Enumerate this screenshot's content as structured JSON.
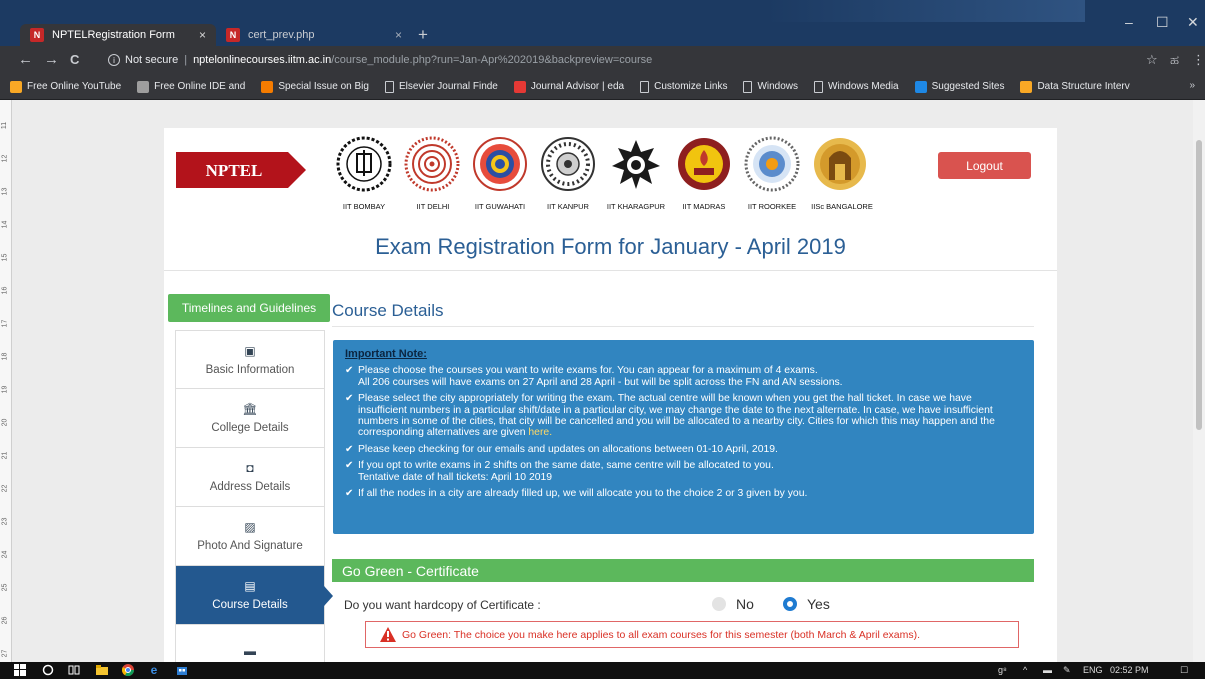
{
  "browser": {
    "tabs": [
      {
        "favicon": "N",
        "title": "NPTELRegistration Form",
        "close": "×"
      },
      {
        "favicon": "N",
        "title": "cert_prev.php",
        "close": "×"
      }
    ],
    "new_tab": "+",
    "window_controls": {
      "minimize": "–",
      "maximize": "☐",
      "close": "✕"
    },
    "nav": {
      "back": "←",
      "forward": "→",
      "reload": "C"
    },
    "address": {
      "security": "Not secure",
      "separator": "|",
      "host": "nptelonlinecourses.iitm.ac.in",
      "path": "/course_module.php?run=Jan-Apr%202019&backpreview=course"
    },
    "toolbar_right": {
      "star": "☆",
      "extension": "ಹ",
      "menu": "⋮"
    },
    "bookmarks": [
      {
        "icon": "download-arrow-icon",
        "color": "#f9a825",
        "label": "Free Online YouTube"
      },
      {
        "icon": "ide-icon",
        "color": "#9e9e9e",
        "label": "Free Online IDE and"
      },
      {
        "icon": "bookmark-page-icon",
        "color": "#f57c00",
        "label": "Special Issue on Big"
      },
      {
        "icon": "page-icon",
        "color": "",
        "label": "Elsevier Journal Finde"
      },
      {
        "icon": "journal-advisor-icon",
        "color": "#e53935",
        "label": "Journal Advisor | eda"
      },
      {
        "icon": "page-icon",
        "color": "",
        "label": "Customize Links"
      },
      {
        "icon": "page-icon",
        "color": "",
        "label": "Windows"
      },
      {
        "icon": "page-icon",
        "color": "",
        "label": "Windows Media"
      },
      {
        "icon": "bing-icon",
        "color": "#1e88e5",
        "label": "Suggested Sites"
      },
      {
        "icon": "data-structure-icon",
        "color": "#f9a825",
        "label": "Data Structure Interv"
      }
    ],
    "bookmarks_overflow": "»"
  },
  "ruler_labels": [
    "11",
    "12",
    "13",
    "14",
    "15",
    "16",
    "17",
    "18",
    "19",
    "20",
    "21",
    "22",
    "23",
    "24",
    "25",
    "26",
    "27"
  ],
  "header": {
    "nptel_logo_text": "NPTEL",
    "institutes": [
      "IIT BOMBAY",
      "IIT DELHI",
      "IIT GUWAHATI",
      "IIT KANPUR",
      "IIT KHARAGPUR",
      "IIT MADRAS",
      "IIT ROORKEE",
      "IISc BANGALORE"
    ],
    "logout_label": "Logout",
    "page_title": "Exam Registration Form for January - April 2019"
  },
  "sidebar": {
    "timelines_label": "Timelines and Guidelines",
    "items": [
      {
        "icon": "id-card-icon",
        "glyph": "▣",
        "label": "Basic Information",
        "active": false
      },
      {
        "icon": "institution-icon",
        "glyph": "🏛",
        "label": "College Details",
        "active": false
      },
      {
        "icon": "address-book-icon",
        "glyph": "◘",
        "label": "Address Details",
        "active": false
      },
      {
        "icon": "photo-icon",
        "glyph": "▨",
        "label": "Photo And Signature",
        "active": false
      },
      {
        "icon": "list-document-icon",
        "glyph": "▤",
        "label": "Course Details",
        "active": true
      },
      {
        "icon": "payment-card-icon",
        "glyph": "▬",
        "label": "",
        "active": false
      }
    ]
  },
  "main": {
    "section_title": "Course Details",
    "note_heading": "Important Note:",
    "notes": [
      {
        "text": "Please choose the courses you want to write exams for. You can appear for a maximum of 4 exams.",
        "text2": "All 206 courses will have exams on 27 April and 28 April - but will be split across the FN and AN sessions."
      },
      {
        "text": "Please select the city appropriately for writing the exam. The actual centre will be known when you get the hall ticket. In case we have insufficient numbers in a particular shift/date in a particular city, we may change the date to the next alternate. In case, we have insufficient numbers in some of the cities, that city will be cancelled and you will be allocated to a nearby city. Cities for which this may happen and the corresponding alternatives are given",
        "link": "here."
      },
      {
        "text": "Please keep checking for our emails and updates on allocations between 01-10 April, 2019."
      },
      {
        "text": "If you opt to write exams in 2 shifts on the same date, same centre will be allocated to you.",
        "text2": "Tentative date of hall tickets: April 10 2019"
      },
      {
        "text": "If all the nodes in a city are already filled up, we will allocate you to the choice 2 or 3 given by you."
      }
    ],
    "go_green_title": "Go Green - Certificate",
    "hardcopy_question": "Do you want hardcopy of Certificate :",
    "options": {
      "no": "No",
      "yes": "Yes",
      "selected": "Yes"
    },
    "go_green_alert": "Go Green: The choice you make here applies to all exam courses for this semester (both March & April exams)."
  },
  "taskbar": {
    "left_icons": [
      "windows-start-icon",
      "search-circle-icon",
      "task-view-icon",
      "file-explorer-icon",
      "chrome-icon",
      "edge-icon",
      "store-icon"
    ],
    "tray": {
      "people": "g⁸",
      "chevron": "^",
      "battery": "▬",
      "pen": "✎",
      "language": "ENG",
      "time": "02:52 PM",
      "notifications": "☐"
    }
  },
  "colors": {
    "primary_blue": "#2b5f95",
    "green": "#5cb85c",
    "logout_red": "#d9534f",
    "note_blue": "#3185c0",
    "nptel_red": "#b3131b"
  }
}
